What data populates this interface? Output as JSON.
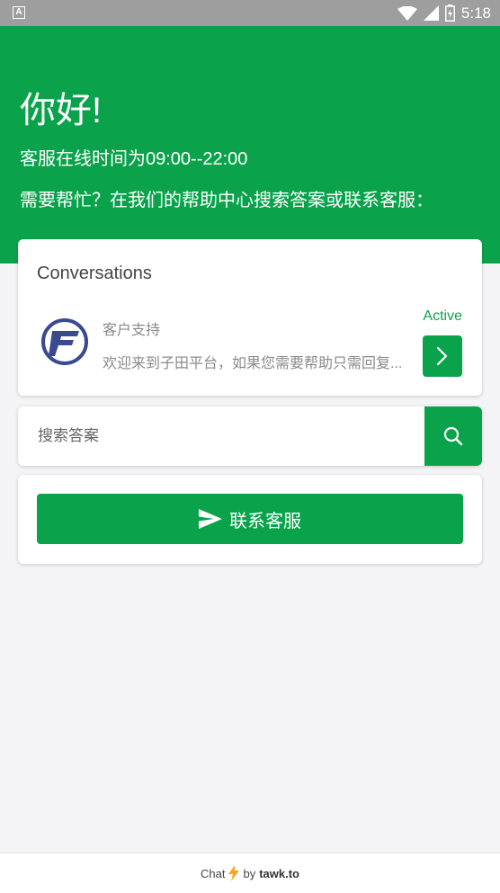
{
  "status_bar": {
    "time": "5:18",
    "notification_letter": "A"
  },
  "header": {
    "greeting": "你好!",
    "hours": "客服在线时间为09:00--22:00",
    "help_text": "需要帮忙？在我们的帮助中心搜索答案或联系客服："
  },
  "conversations": {
    "title": "Conversations",
    "item": {
      "name": "客户支持",
      "message": "欢迎来到子田平台，如果您需要帮助只需回复...",
      "status": "Active"
    }
  },
  "search": {
    "placeholder": "搜索答案"
  },
  "contact": {
    "label": "联系客服"
  },
  "footer": {
    "chat": "Chat",
    "by": "by",
    "brand": "tawk.to"
  },
  "colors": {
    "accent": "#0aa34b",
    "background": "#f4f4f6",
    "status_bar": "#9e9e9e"
  },
  "icons": [
    "wifi-icon",
    "signal-icon",
    "battery-icon",
    "chevron-right-icon",
    "search-icon",
    "send-icon",
    "lightning-icon"
  ]
}
